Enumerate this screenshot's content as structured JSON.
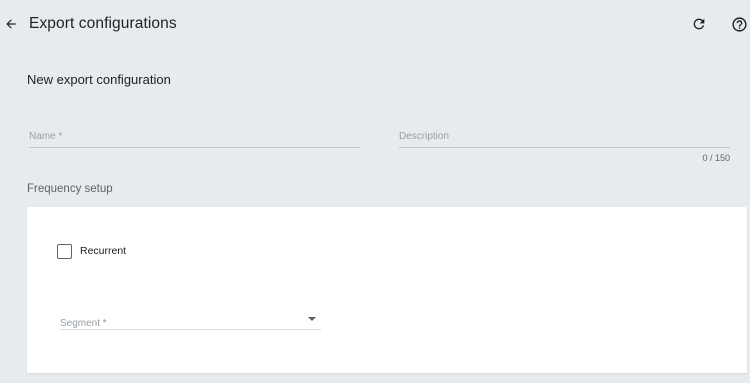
{
  "header": {
    "title": "Export configurations",
    "back_icon": "arrow-left-icon",
    "refresh_icon": "refresh-icon",
    "help_icon": "help-circle-icon"
  },
  "form": {
    "section_title": "New export configuration",
    "name_label": "Name *",
    "description_label": "Description",
    "description_counter": "0 / 150"
  },
  "frequency": {
    "title": "Frequency setup",
    "recurrent_label": "Recurrent",
    "recurrent_checked": false,
    "segment_label": "Segment *"
  },
  "colors": {
    "background": "#e8ebee",
    "card": "#ffffff",
    "text_primary": "#202124",
    "text_secondary": "#5f6368",
    "placeholder": "#9aa0a6"
  }
}
